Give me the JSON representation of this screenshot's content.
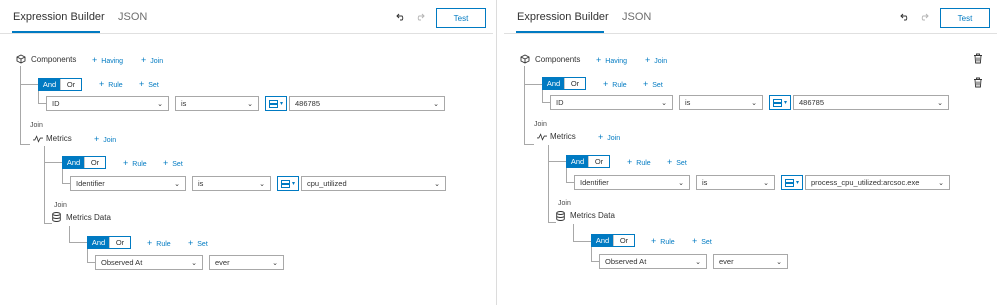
{
  "tabs": {
    "expression_builder": "Expression Builder",
    "json": "JSON"
  },
  "test_label": "Test",
  "common": {
    "components": "Components",
    "having": "Having",
    "join": "Join",
    "and": "And",
    "or": "Or",
    "rule": "Rule",
    "set": "Set",
    "metrics": "Metrics",
    "metrics_data": "Metrics Data",
    "is": "is",
    "ever": "ever",
    "id_field": "ID",
    "identifier_field": "Identifier",
    "observed_at_field": "Observed At"
  },
  "left": {
    "id_value": "486785",
    "identifier_value": "cpu_utilized"
  },
  "right": {
    "id_value": "486785",
    "identifier_value": "process_cpu_utilized:arcsoc.exe"
  },
  "colors": {
    "accent": "#007ac2",
    "text": "#323232",
    "border": "#a8a8a8"
  }
}
